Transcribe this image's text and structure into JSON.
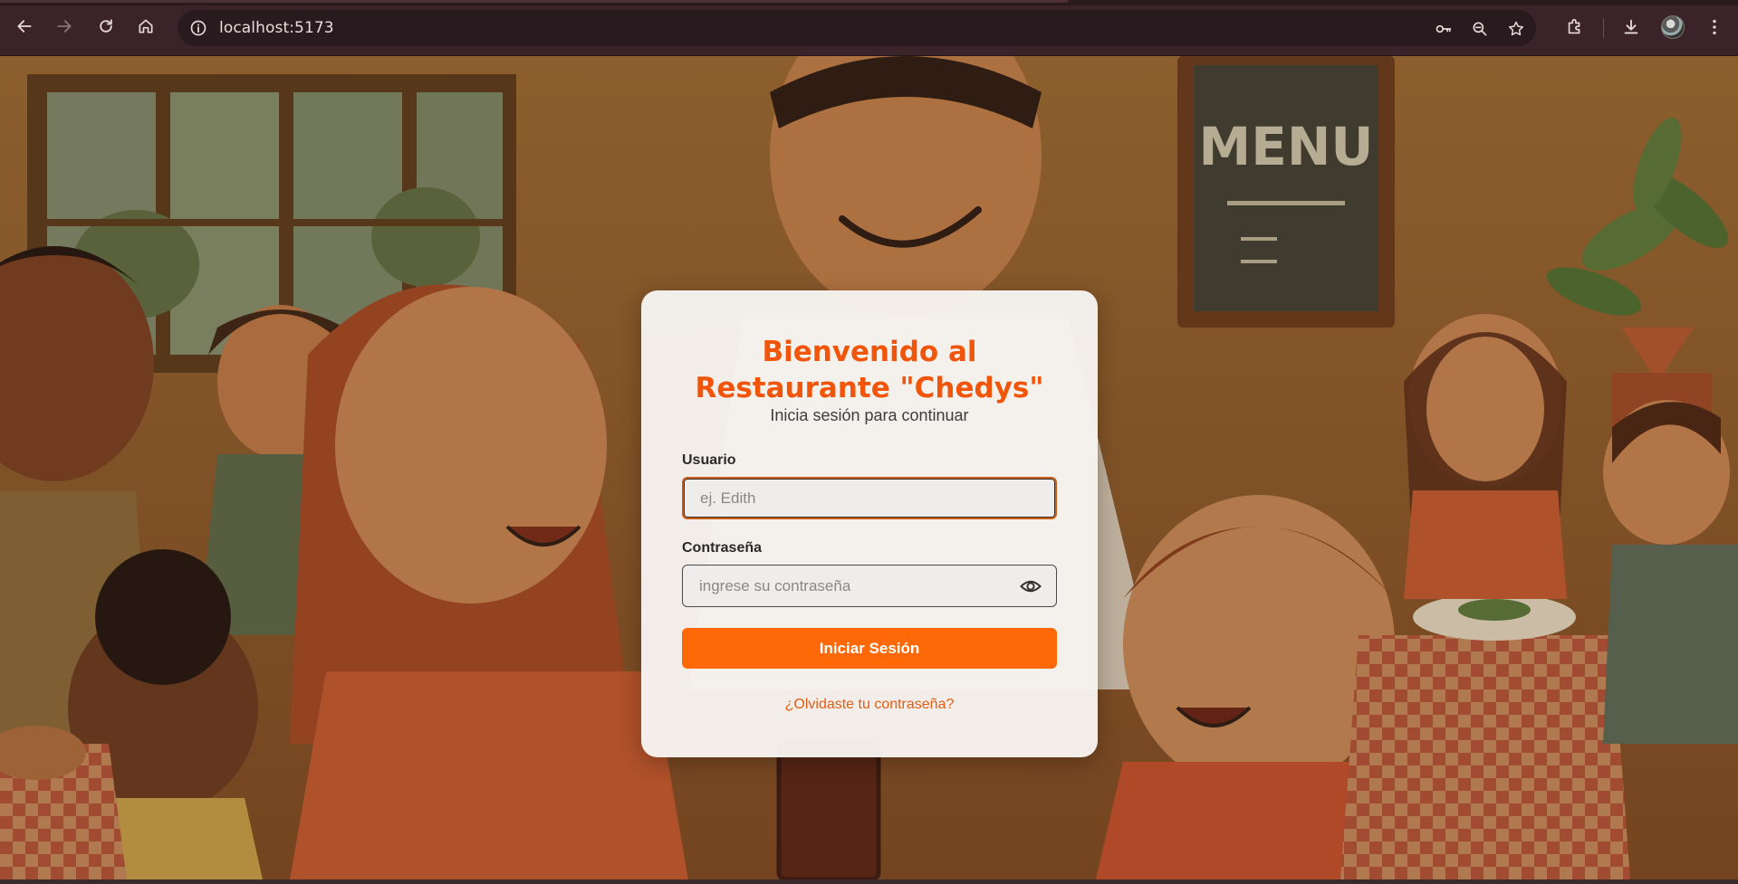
{
  "browser": {
    "url": "localhost:5173",
    "icons": {
      "back": "arrow-left-icon",
      "forward": "arrow-right-icon",
      "reload": "reload-icon",
      "home": "home-icon",
      "site_info": "info-icon",
      "password": "key-icon",
      "zoom": "zoom-out-icon",
      "bookmark": "star-icon",
      "extensions": "puzzle-icon",
      "downloads": "download-icon",
      "menu": "kebab-menu-icon"
    }
  },
  "background": {
    "menu_board_text": "MENU"
  },
  "login": {
    "title_line1": "Bienvenido al",
    "title_line2": "Restaurante \"Chedys\"",
    "subtitle": "Inicia sesión para continuar",
    "username_label": "Usuario",
    "username_value": "",
    "username_placeholder": "ej. Edith",
    "password_label": "Contraseña",
    "password_value": "",
    "password_placeholder": "ingrese su contraseña",
    "submit_label": "Iniciar Sesión",
    "forgot_label": "¿Olvidaste tu contraseña?"
  },
  "colors": {
    "accent": "#f0550a",
    "button": "#fe6807",
    "card": "#f6f3f0"
  }
}
